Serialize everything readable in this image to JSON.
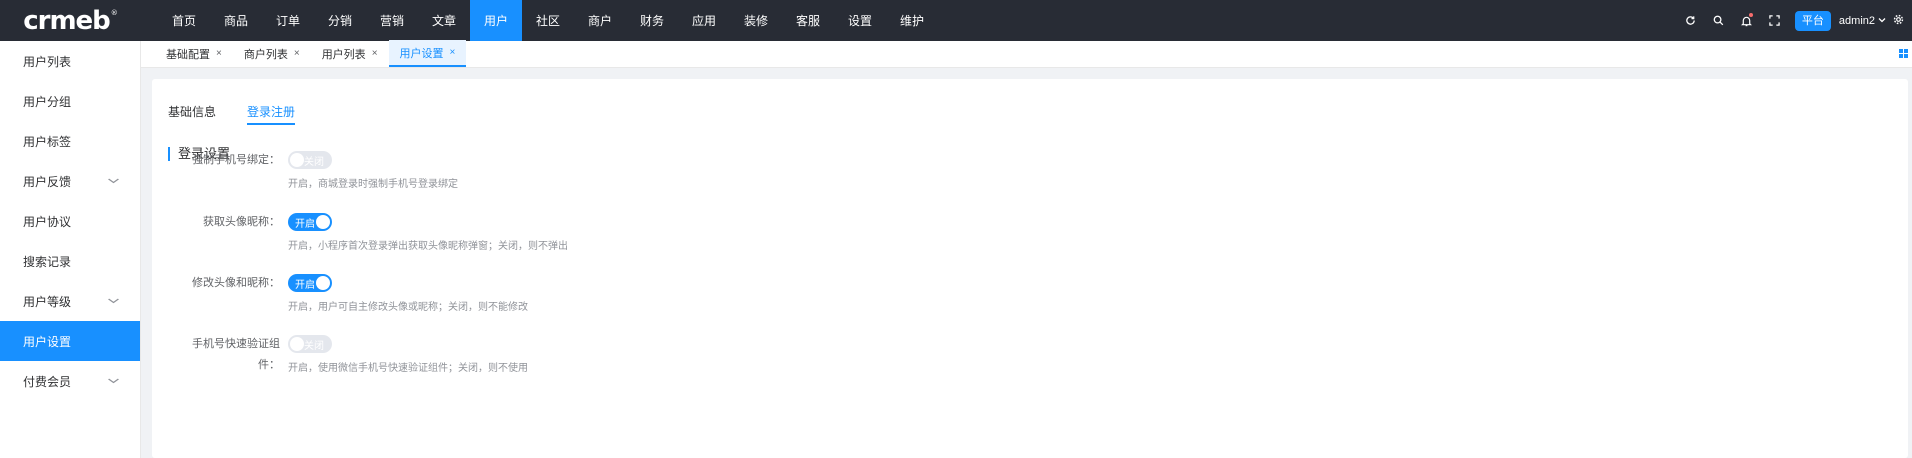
{
  "brand": {
    "logo": "crmeb",
    "logo_mark": "®"
  },
  "topnav": [
    "首页",
    "商品",
    "订单",
    "分销",
    "营销",
    "文章",
    "用户",
    "社区",
    "商户",
    "财务",
    "应用",
    "装修",
    "客服",
    "设置",
    "维护"
  ],
  "topnav_active_index": 6,
  "header_right": {
    "platform_label": "平台",
    "username": "admin2",
    "icons": [
      "refresh-icon",
      "search-icon",
      "bell-icon",
      "fullscreen-icon",
      "chevron-down-icon",
      "gear-icon"
    ]
  },
  "sidebar": {
    "items": [
      {
        "label": "用户列表",
        "has_arrow": false
      },
      {
        "label": "用户分组",
        "has_arrow": false
      },
      {
        "label": "用户标签",
        "has_arrow": false
      },
      {
        "label": "用户反馈",
        "has_arrow": true
      },
      {
        "label": "用户协议",
        "has_arrow": false
      },
      {
        "label": "搜索记录",
        "has_arrow": false
      },
      {
        "label": "用户等级",
        "has_arrow": true
      },
      {
        "label": "用户设置",
        "has_arrow": false
      },
      {
        "label": "付费会员",
        "has_arrow": true
      }
    ],
    "active_index": 7
  },
  "tabs": [
    {
      "label": "基础配置"
    },
    {
      "label": "商户列表"
    },
    {
      "label": "用户列表"
    },
    {
      "label": "用户设置"
    }
  ],
  "tabs_active_index": 3,
  "tab_close": "×",
  "sub_tabs": [
    "基础信息",
    "登录注册"
  ],
  "sub_tabs_active_index": 1,
  "section_title": "登录设置",
  "settings": [
    {
      "label": "强制手机号绑定：",
      "label_line2": "",
      "state": "关闭",
      "on": false,
      "help": "开启，商城登录时强制手机号登录绑定"
    },
    {
      "label": "获取头像昵称：",
      "label_line2": "",
      "state": "开启",
      "on": true,
      "help": "开启，小程序首次登录弹出获取头像昵称弹窗；关闭，则不弹出"
    },
    {
      "label": "修改头像和昵称：",
      "label_line2": "",
      "state": "开启",
      "on": true,
      "help": "开启，用户可自主修改头像或昵称；关闭，则不能修改"
    },
    {
      "label": "手机号快速验证组",
      "label_line2": "件：",
      "state": "关闭",
      "on": false,
      "help": "开启，使用微信手机号快速验证组件；关闭，则不使用"
    }
  ],
  "colors": {
    "primary": "#1890ff",
    "topbar": "#282c35",
    "switch_off": "#e4e7ed"
  }
}
